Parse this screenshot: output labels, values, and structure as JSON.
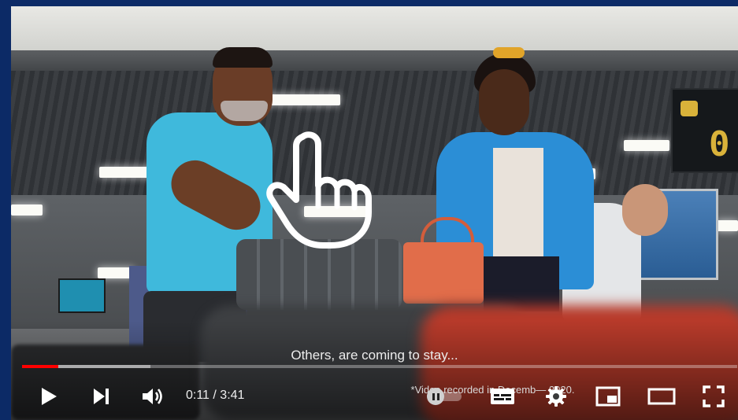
{
  "player": {
    "caption": "Others, are coming  to stay...",
    "footnote": "*Video recorded in Decemb— 2020.",
    "time": {
      "current": "0:11",
      "separator": " / ",
      "duration": "3:41"
    },
    "progress": {
      "played_fraction": 0.051,
      "buffered_fraction": 0.18,
      "played_color": "#ff0000"
    },
    "autoplay": {
      "state": "on"
    },
    "controls": [
      "play-icon",
      "next-icon",
      "volume-icon",
      "autoplay-toggle",
      "subtitles-icon",
      "gear-icon",
      "miniplayer-icon",
      "theater-mode-icon",
      "fullscreen-icon"
    ]
  },
  "scene": {
    "sign_number": "0"
  }
}
